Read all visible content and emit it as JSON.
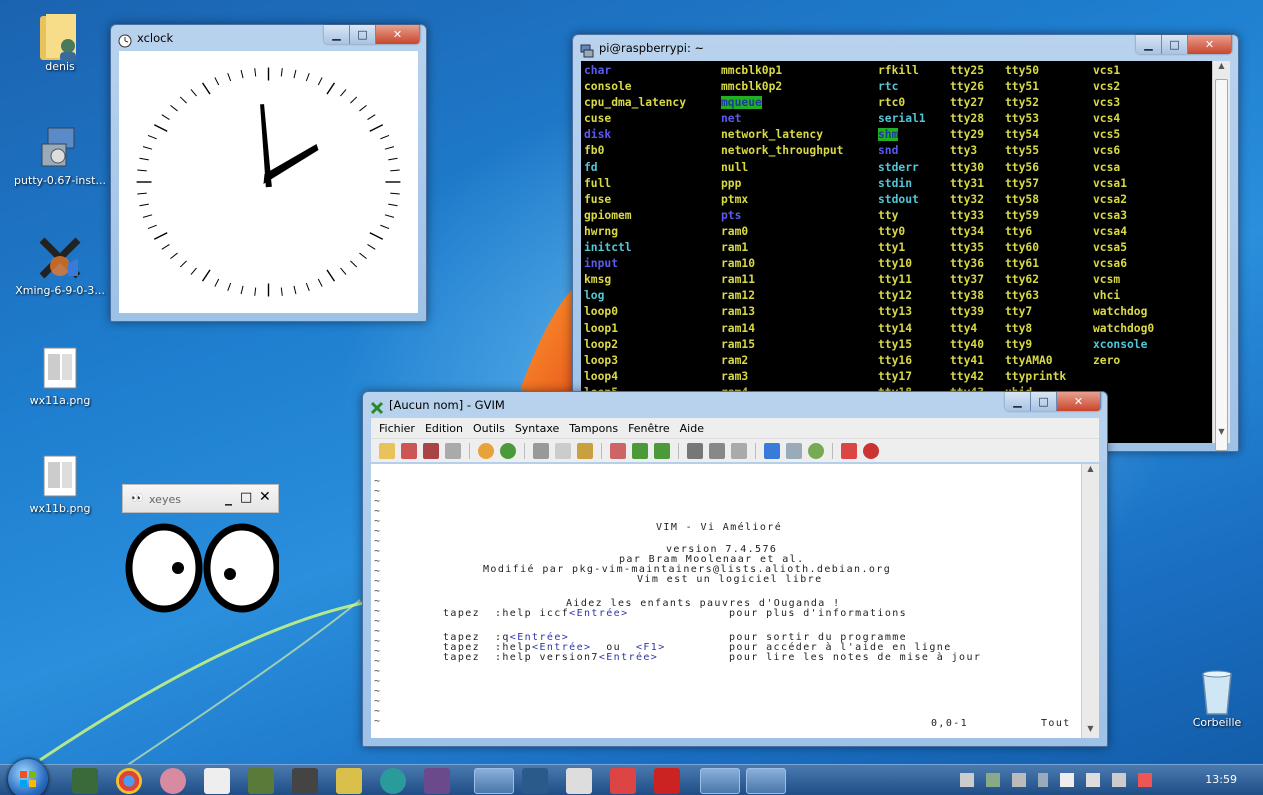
{
  "desktop": {
    "icons": [
      {
        "label": "denis",
        "icon": "user-folder-icon"
      },
      {
        "label": "putty-0.67-inst...",
        "icon": "installer-icon"
      },
      {
        "label": "Xming-6-9-0-3...",
        "icon": "xming-icon"
      },
      {
        "label": "wx11a.png",
        "icon": "image-file-icon"
      },
      {
        "label": "wx11b.png",
        "icon": "image-file-icon"
      },
      {
        "label": "Corbeille",
        "icon": "recycle-bin-icon"
      }
    ]
  },
  "xclock": {
    "title": "xclock"
  },
  "terminal": {
    "title": "pi@raspberrypi: ~",
    "rows": [
      [
        [
          "char",
          "b"
        ],
        [
          "mmcblk0p1",
          "y"
        ],
        [
          "rfkill",
          "y"
        ],
        [
          "tty25",
          "y"
        ],
        [
          "tty50",
          "y"
        ],
        [
          "vcs1",
          "y"
        ]
      ],
      [
        [
          "console",
          "y"
        ],
        [
          "mmcblk0p2",
          "y"
        ],
        [
          "rtc",
          "c"
        ],
        [
          "tty26",
          "y"
        ],
        [
          "tty51",
          "y"
        ],
        [
          "vcs2",
          "y"
        ]
      ],
      [
        [
          "cpu_dma_latency",
          "y"
        ],
        [
          "mqueue",
          "hl"
        ],
        [
          "rtc0",
          "y"
        ],
        [
          "tty27",
          "y"
        ],
        [
          "tty52",
          "y"
        ],
        [
          "vcs3",
          "y"
        ]
      ],
      [
        [
          "cuse",
          "y"
        ],
        [
          "net",
          "b"
        ],
        [
          "serial1",
          "c"
        ],
        [
          "tty28",
          "y"
        ],
        [
          "tty53",
          "y"
        ],
        [
          "vcs4",
          "y"
        ]
      ],
      [
        [
          "disk",
          "b"
        ],
        [
          "network_latency",
          "y"
        ],
        [
          "shm",
          "hl"
        ],
        [
          "tty29",
          "y"
        ],
        [
          "tty54",
          "y"
        ],
        [
          "vcs5",
          "y"
        ]
      ],
      [
        [
          "fb0",
          "y"
        ],
        [
          "network_throughput",
          "y"
        ],
        [
          "snd",
          "b"
        ],
        [
          "tty3",
          "y"
        ],
        [
          "tty55",
          "y"
        ],
        [
          "vcs6",
          "y"
        ]
      ],
      [
        [
          "fd",
          "c"
        ],
        [
          "null",
          "y"
        ],
        [
          "stderr",
          "c"
        ],
        [
          "tty30",
          "y"
        ],
        [
          "tty56",
          "y"
        ],
        [
          "vcsa",
          "y"
        ]
      ],
      [
        [
          "full",
          "y"
        ],
        [
          "ppp",
          "y"
        ],
        [
          "stdin",
          "c"
        ],
        [
          "tty31",
          "y"
        ],
        [
          "tty57",
          "y"
        ],
        [
          "vcsa1",
          "y"
        ]
      ],
      [
        [
          "fuse",
          "y"
        ],
        [
          "ptmx",
          "y"
        ],
        [
          "stdout",
          "c"
        ],
        [
          "tty32",
          "y"
        ],
        [
          "tty58",
          "y"
        ],
        [
          "vcsa2",
          "y"
        ]
      ],
      [
        [
          "gpiomem",
          "y"
        ],
        [
          "pts",
          "b"
        ],
        [
          "tty",
          "y"
        ],
        [
          "tty33",
          "y"
        ],
        [
          "tty59",
          "y"
        ],
        [
          "vcsa3",
          "y"
        ]
      ],
      [
        [
          "hwrng",
          "y"
        ],
        [
          "ram0",
          "y"
        ],
        [
          "tty0",
          "y"
        ],
        [
          "tty34",
          "y"
        ],
        [
          "tty6",
          "y"
        ],
        [
          "vcsa4",
          "y"
        ]
      ],
      [
        [
          "initctl",
          "c"
        ],
        [
          "ram1",
          "y"
        ],
        [
          "tty1",
          "y"
        ],
        [
          "tty35",
          "y"
        ],
        [
          "tty60",
          "y"
        ],
        [
          "vcsa5",
          "y"
        ]
      ],
      [
        [
          "input",
          "b"
        ],
        [
          "ram10",
          "y"
        ],
        [
          "tty10",
          "y"
        ],
        [
          "tty36",
          "y"
        ],
        [
          "tty61",
          "y"
        ],
        [
          "vcsa6",
          "y"
        ]
      ],
      [
        [
          "kmsg",
          "y"
        ],
        [
          "ram11",
          "y"
        ],
        [
          "tty11",
          "y"
        ],
        [
          "tty37",
          "y"
        ],
        [
          "tty62",
          "y"
        ],
        [
          "vcsm",
          "y"
        ]
      ],
      [
        [
          "log",
          "c"
        ],
        [
          "ram12",
          "y"
        ],
        [
          "tty12",
          "y"
        ],
        [
          "tty38",
          "y"
        ],
        [
          "tty63",
          "y"
        ],
        [
          "vhci",
          "y"
        ]
      ],
      [
        [
          "loop0",
          "y"
        ],
        [
          "ram13",
          "y"
        ],
        [
          "tty13",
          "y"
        ],
        [
          "tty39",
          "y"
        ],
        [
          "tty7",
          "y"
        ],
        [
          "watchdog",
          "y"
        ]
      ],
      [
        [
          "loop1",
          "y"
        ],
        [
          "ram14",
          "y"
        ],
        [
          "tty14",
          "y"
        ],
        [
          "tty4",
          "y"
        ],
        [
          "tty8",
          "y"
        ],
        [
          "watchdog0",
          "y"
        ]
      ],
      [
        [
          "loop2",
          "y"
        ],
        [
          "ram15",
          "y"
        ],
        [
          "tty15",
          "y"
        ],
        [
          "tty40",
          "y"
        ],
        [
          "tty9",
          "y"
        ],
        [
          "xconsole",
          "c"
        ]
      ],
      [
        [
          "loop3",
          "y"
        ],
        [
          "ram2",
          "y"
        ],
        [
          "tty16",
          "y"
        ],
        [
          "tty41",
          "y"
        ],
        [
          "ttyAMA0",
          "y"
        ],
        [
          "zero",
          "y"
        ]
      ],
      [
        [
          "loop4",
          "y"
        ],
        [
          "ram3",
          "y"
        ],
        [
          "tty17",
          "y"
        ],
        [
          "tty42",
          "y"
        ],
        [
          "ttyprintk",
          "y"
        ],
        [
          "",
          ""
        ]
      ],
      [
        [
          "loop5",
          "y"
        ],
        [
          "ram4",
          "y"
        ],
        [
          "tty18",
          "y"
        ],
        [
          "tty43",
          "y"
        ],
        [
          "uhid",
          "y"
        ],
        [
          "",
          ""
        ]
      ]
    ]
  },
  "gvim": {
    "title": "[Aucun nom] - GVIM",
    "menu": [
      "Fichier",
      "Edition",
      "Outils",
      "Syntaxe",
      "Tampons",
      "Fenêtre",
      "Aide"
    ],
    "intro": {
      "line1": "VIM - Vi Amélioré",
      "line2": "version 7.4.576",
      "line3": "par Bram Moolenaar et al.",
      "line4": "Modifié par pkg-vim-maintainers@lists.alioth.debian.org",
      "line5": "Vim est un logiciel libre",
      "line6": "Aidez les enfants pauvres d'Ouganda !",
      "h1a": "tapez  :help iccf",
      "h1k": "<Entrée>",
      "h1c": "pour plus d'informations",
      "h2a": "tapez  :q",
      "h2k": "<Entrée>",
      "h2c": "pour sortir du programme",
      "h3a": "tapez  :help",
      "h3k": "<Entrée>",
      "h3m": "  ou  ",
      "h3k2": "<F1>",
      "h3c": "pour accéder à l'aide en ligne",
      "h4a": "tapez  :help version7",
      "h4k": "<Entrée>",
      "h4c": "pour lire les notes de mise à jour"
    },
    "ruler": "0,0-1",
    "position": "Tout"
  },
  "xeyes": {
    "title": "xeyes"
  },
  "taskbar": {
    "time": "13:59"
  }
}
